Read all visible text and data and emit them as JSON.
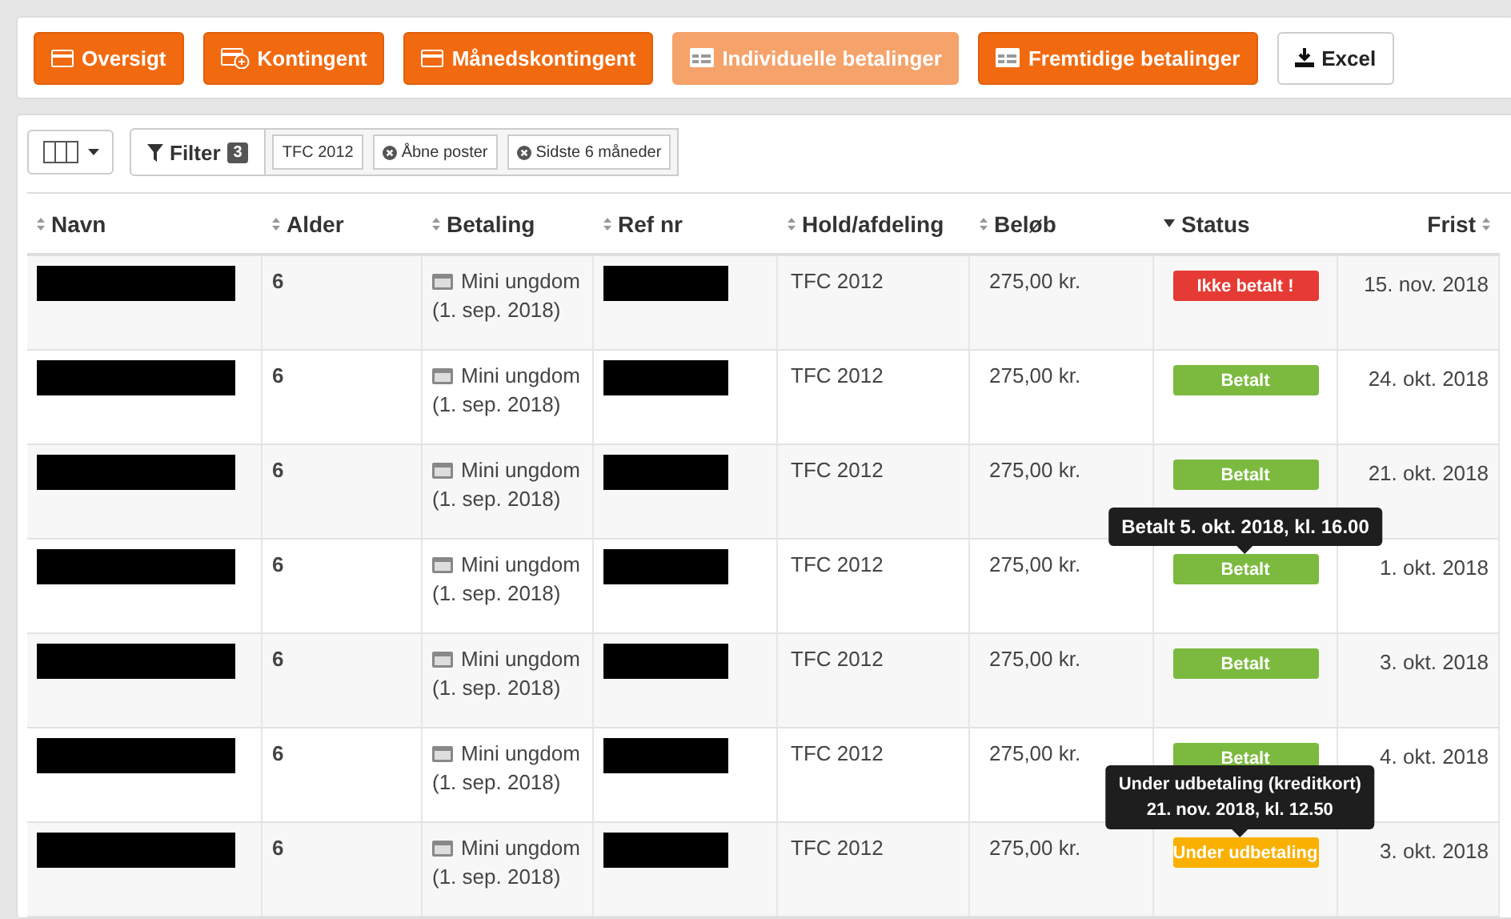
{
  "nav_buttons": [
    {
      "label": "Oversigt",
      "kind": "card",
      "selected": false
    },
    {
      "label": "Kontingent",
      "kind": "card-plus",
      "selected": false
    },
    {
      "label": "Månedskontingent",
      "kind": "card",
      "selected": false
    },
    {
      "label": "Individuelle betalinger",
      "kind": "card-list",
      "selected": true
    },
    {
      "label": "Fremtidige betalinger",
      "kind": "card-list",
      "selected": false
    }
  ],
  "export_button": {
    "label": "Excel"
  },
  "toolbar": {
    "filter_label": "Filter",
    "filter_count": "3",
    "chips": [
      {
        "label": "TFC 2012",
        "removable": false
      },
      {
        "label": "Åbne poster",
        "removable": true
      },
      {
        "label": "Sidste 6 måneder",
        "removable": true
      }
    ]
  },
  "table": {
    "columns": [
      {
        "label": "Navn",
        "sorted": false
      },
      {
        "label": "Alder",
        "sorted": false
      },
      {
        "label": "Betaling",
        "sorted": false
      },
      {
        "label": "Ref nr",
        "sorted": false
      },
      {
        "label": "Hold/afdeling",
        "sorted": false
      },
      {
        "label": "Beløb",
        "sorted": false
      },
      {
        "label": "Status",
        "sorted": true
      },
      {
        "label": "Frist",
        "sorted": false
      }
    ],
    "rows": [
      {
        "age": "6",
        "payment": "Mini ungdom",
        "payment_date": "(1. sep. 2018)",
        "team": "TFC 2012",
        "amount": "275,00 kr.",
        "status": "Ikke betalt !",
        "color": "#e53b34",
        "deadline": "15. nov. 2018"
      },
      {
        "age": "6",
        "payment": "Mini ungdom",
        "payment_date": "(1. sep. 2018)",
        "team": "TFC 2012",
        "amount": "275,00 kr.",
        "status": "Betalt",
        "color": "#7cba3f",
        "deadline": "24. okt. 2018"
      },
      {
        "age": "6",
        "payment": "Mini ungdom",
        "payment_date": "(1. sep. 2018)",
        "team": "TFC 2012",
        "amount": "275,00 kr.",
        "status": "Betalt",
        "color": "#7cba3f",
        "deadline": "21. okt. 2018"
      },
      {
        "age": "6",
        "payment": "Mini ungdom",
        "payment_date": "(1. sep. 2018)",
        "team": "TFC 2012",
        "amount": "275,00 kr.",
        "status": "Betalt",
        "color": "#7cba3f",
        "deadline": "1. okt. 2018",
        "tooltip": "Betalt 5. okt. 2018, kl. 16.00"
      },
      {
        "age": "6",
        "payment": "Mini ungdom",
        "payment_date": "(1. sep. 2018)",
        "team": "TFC 2012",
        "amount": "275,00 kr.",
        "status": "Betalt",
        "color": "#7cba3f",
        "deadline": "3. okt. 2018"
      },
      {
        "age": "6",
        "payment": "Mini ungdom",
        "payment_date": "(1. sep. 2018)",
        "team": "TFC 2012",
        "amount": "275,00 kr.",
        "status": "Betalt",
        "color": "#7cba3f",
        "deadline": "4. okt. 2018"
      },
      {
        "age": "6",
        "payment": "Mini ungdom",
        "payment_date": "(1. sep. 2018)",
        "team": "TFC 2012",
        "amount": "275,00 kr.",
        "status": "Under udbetaling",
        "color": "#f9b000",
        "deadline": "3. okt. 2018",
        "tooltip": "Under udbetaling (kreditkort) 21. nov. 2018, kl. 12.50"
      }
    ]
  }
}
